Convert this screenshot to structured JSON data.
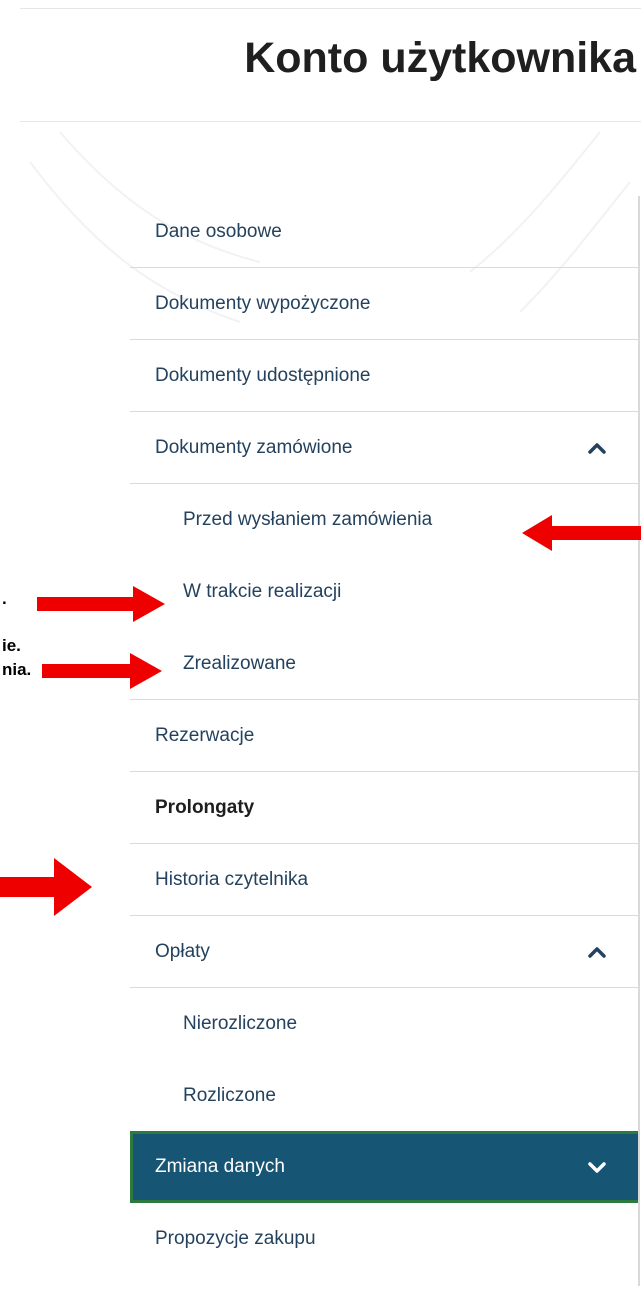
{
  "header": {
    "title": "Konto użytkownika"
  },
  "menu": {
    "items": [
      {
        "label": "Dane osobowe"
      },
      {
        "label": "Dokumenty wypożyczone"
      },
      {
        "label": "Dokumenty udostępnione"
      },
      {
        "label": "Dokumenty zamówione",
        "icon": "chevron-up-icon",
        "expanded": true
      },
      {
        "label": "Przed wysłaniem zamówienia"
      },
      {
        "label": "W trakcie realizacji"
      },
      {
        "label": "Zrealizowane"
      },
      {
        "label": "Rezerwacje"
      },
      {
        "label": "Prolongaty"
      },
      {
        "label": "Historia czytelnika"
      },
      {
        "label": "Opłaty",
        "icon": "chevron-up-icon",
        "expanded": true
      },
      {
        "label": "Nierozliczone"
      },
      {
        "label": "Rozliczone"
      },
      {
        "label": "Zmiana danych",
        "icon": "chevron-down-icon",
        "active": true
      },
      {
        "label": "Propozycje zakupu"
      }
    ]
  },
  "annotations": {
    "fragment_1": ".",
    "fragment_2": "ie.",
    "fragment_3": "nia."
  },
  "colors": {
    "active_bg": "#175574",
    "active_border": "#2c7a3e",
    "link_text": "#24425d",
    "arrow": "#ee0000"
  }
}
